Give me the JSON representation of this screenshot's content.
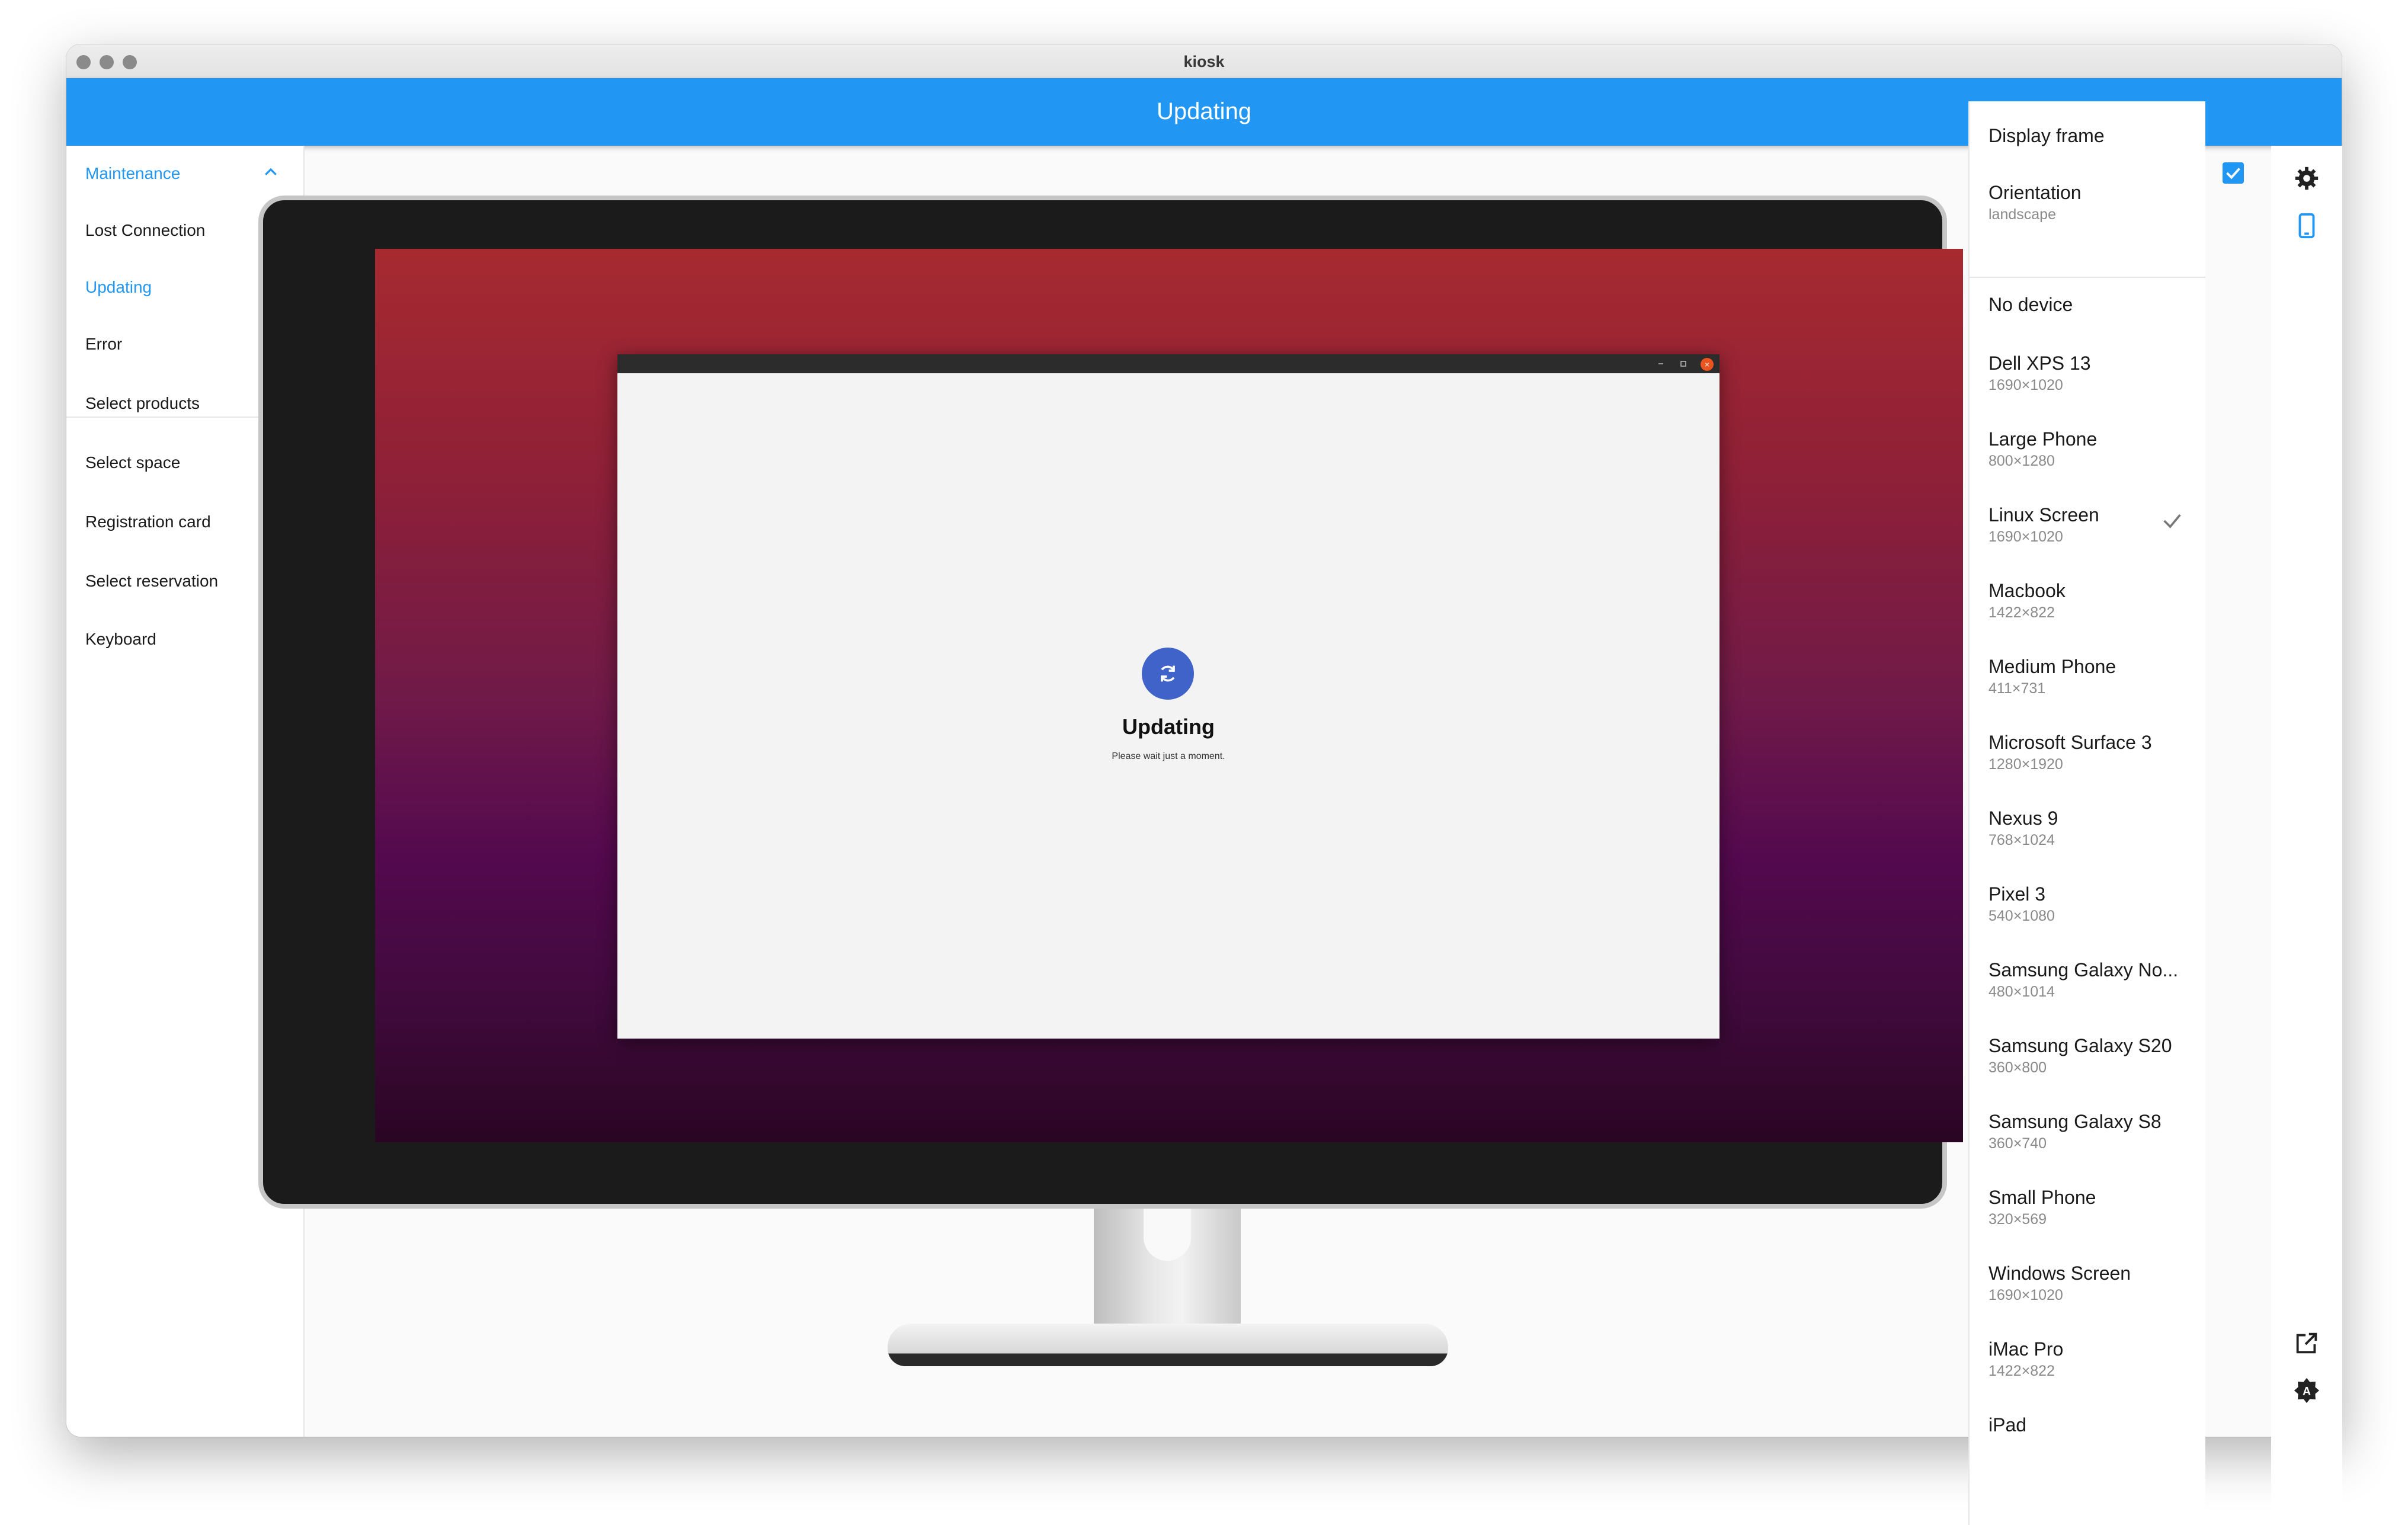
{
  "window": {
    "title": "kiosk"
  },
  "appbar": {
    "title": "Updating"
  },
  "nav": {
    "items": [
      {
        "label": "Maintenance",
        "expanded": true,
        "active": true
      },
      {
        "label": "Lost Connection"
      },
      {
        "label": "Updating",
        "active": true
      },
      {
        "label": "Error"
      },
      {
        "label": "Select products",
        "expandable": true
      },
      {
        "label": "Select space",
        "expandable": true
      },
      {
        "label": "Registration card",
        "expandable": true
      },
      {
        "label": "Select reservation",
        "expandable": true
      },
      {
        "label": "Keyboard"
      }
    ]
  },
  "preview": {
    "heading": "Updating",
    "subtext": "Please wait just a moment.",
    "icon": "refresh-icon"
  },
  "devices": {
    "display_frame_label": "Display frame",
    "display_frame_checked": true,
    "orientation_label": "Orientation",
    "orientation_value": "landscape",
    "list": [
      {
        "name": "No device",
        "size": ""
      },
      {
        "name": "Dell XPS 13",
        "size": "1690×1020"
      },
      {
        "name": "Large Phone",
        "size": "800×1280"
      },
      {
        "name": "Linux Screen",
        "size": "1690×1020",
        "selected": true
      },
      {
        "name": "Macbook",
        "size": "1422×822"
      },
      {
        "name": "Medium Phone",
        "size": "411×731"
      },
      {
        "name": "Microsoft Surface 3",
        "size": "1280×1920"
      },
      {
        "name": "Nexus 9",
        "size": "768×1024"
      },
      {
        "name": "Pixel 3",
        "size": "540×1080"
      },
      {
        "name": "Samsung Galaxy No...",
        "size": "480×1014"
      },
      {
        "name": "Samsung Galaxy S20",
        "size": "360×800"
      },
      {
        "name": "Samsung Galaxy S8",
        "size": "360×740"
      },
      {
        "name": "Small Phone",
        "size": "320×569"
      },
      {
        "name": "Windows Screen",
        "size": "1690×1020"
      },
      {
        "name": "iMac Pro",
        "size": "1422×822"
      },
      {
        "name": "iPad",
        "size": ""
      }
    ]
  },
  "colors": {
    "accent": "#2196f3",
    "ubuntu_close": "#e95420",
    "update_icon_bg": "#3f63c9"
  },
  "toolbar": {
    "icons": [
      "gear-icon",
      "phone-icon",
      "open-external-icon",
      "theme-icon"
    ]
  }
}
